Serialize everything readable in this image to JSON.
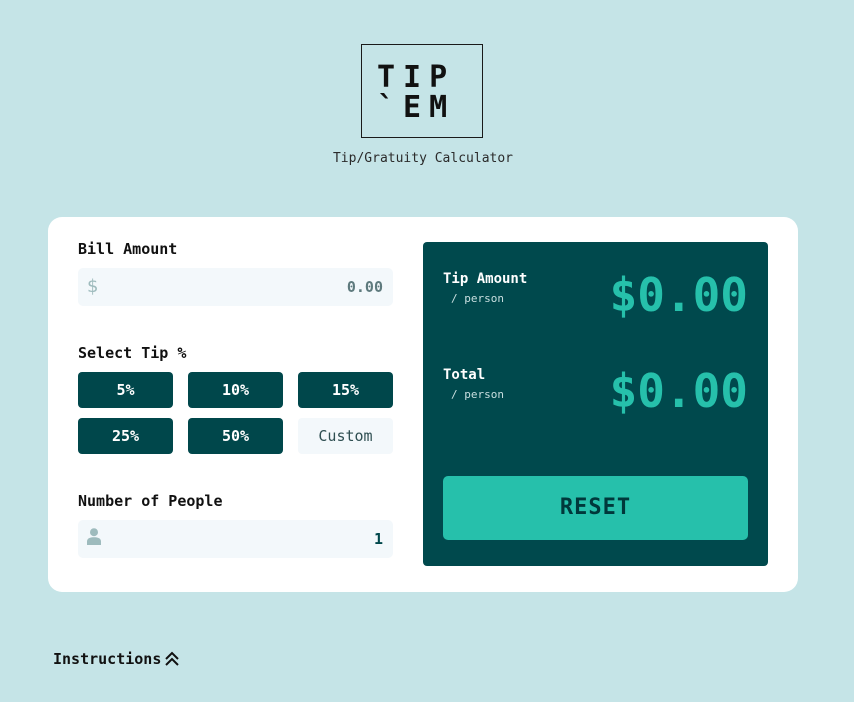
{
  "header": {
    "logo_line1": "TIP",
    "logo_line2": "`EM",
    "subtitle": "Tip/Gratuity Calculator"
  },
  "form": {
    "bill_label": "Bill Amount",
    "bill_icon": "dollar-icon",
    "bill_icon_glyph": "$",
    "bill_value": "0.00",
    "tip_label": "Select Tip %",
    "tip_options": [
      "5%",
      "10%",
      "15%",
      "25%",
      "50%"
    ],
    "custom_label": "Custom",
    "people_label": "Number of People",
    "people_icon": "person-icon",
    "people_value": "1"
  },
  "results": {
    "tip_label": "Tip Amount",
    "tip_sub": "/ person",
    "tip_value": "$0.00",
    "total_label": "Total",
    "total_sub": "/ person",
    "total_value": "$0.00",
    "reset_label": "RESET"
  },
  "footer": {
    "instructions_label": "Instructions",
    "instructions_icon": "double-chevron-up-icon"
  },
  "colors": {
    "background": "#c5e4e7",
    "dark_cyan": "#00474b",
    "accent_teal": "#26c0ab",
    "input_bg": "#f3f8fb"
  }
}
